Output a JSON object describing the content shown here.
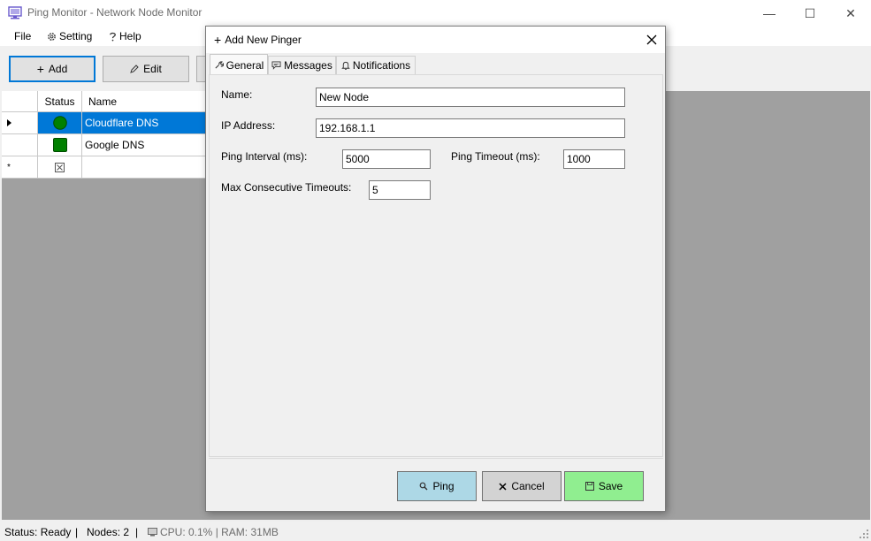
{
  "window": {
    "title": "Ping Monitor - Network Node Monitor",
    "controls": {
      "minimize": "—",
      "maximize": "☐",
      "close": "✕"
    }
  },
  "menu": {
    "file": "File",
    "setting": "Setting",
    "help": "Help"
  },
  "toolbar": {
    "add_label": "Add",
    "edit_label": "Edit"
  },
  "grid": {
    "headers": {
      "status": "Status",
      "name": "Name"
    },
    "rows": [
      {
        "name": "Cloudflare DNS",
        "status_color": "#008000",
        "selected": true
      },
      {
        "name": "Google DNS",
        "status_color": "#008000",
        "selected": false
      }
    ],
    "new_row_marker": "*"
  },
  "statusbar": {
    "status": "Status: Ready",
    "separator": "|",
    "nodes": "Nodes: 2",
    "separator2": "|",
    "resources": "CPU: 0.1% | RAM: 31MB"
  },
  "dialog": {
    "title": "Add New Pinger",
    "tabs": {
      "general": "General",
      "messages": "Messages",
      "notifications": "Notifications"
    },
    "fields": {
      "name_label": "Name:",
      "name_value": "New Node",
      "ip_label": "IP Address:",
      "ip_value": "192.168.1.1",
      "interval_label": "Ping Interval (ms):",
      "interval_value": "5000",
      "timeout_label": "Ping Timeout (ms):",
      "timeout_value": "1000",
      "max_timeouts_label": "Max Consecutive Timeouts:",
      "max_timeouts_value": "5"
    },
    "buttons": {
      "ping": "Ping",
      "cancel": "Cancel",
      "save": "Save"
    }
  },
  "colors": {
    "selection": "#0078d7",
    "ping_button": "#add8e6",
    "cancel_button": "#d3d3d3",
    "save_button": "#90ee90",
    "status_green": "#008000"
  }
}
